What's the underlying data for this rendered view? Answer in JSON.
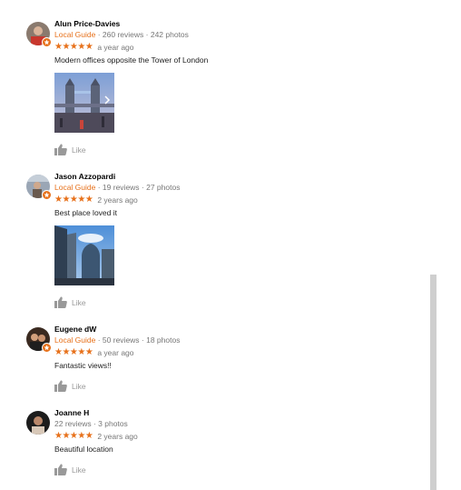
{
  "reviews": [
    {
      "name": "Alun Price-Davies",
      "local_guide": "Local Guide",
      "stats": " · 260 reviews · 242 photos",
      "stars": "★★★★★",
      "time": "a year ago",
      "text": "Modern offices opposite the Tower of London",
      "like": "Like"
    },
    {
      "name": "Jason Azzopardi",
      "local_guide": "Local Guide",
      "stats": " · 19 reviews · 27 photos",
      "stars": "★★★★★",
      "time": "2 years ago",
      "text": "Best place loved it",
      "like": "Like"
    },
    {
      "name": "Eugene dW",
      "local_guide": "Local Guide",
      "stats": " · 50 reviews · 18 photos",
      "stars": "★★★★★",
      "time": "a year ago",
      "text": "Fantastic views!!",
      "like": "Like"
    },
    {
      "name": "Joanne H",
      "stats": "22 reviews · 3 photos",
      "stars": "★★★★★",
      "time": "2 years ago",
      "text": "Beautiful location",
      "like": "Like"
    }
  ],
  "colors": {
    "accent": "#e7711b",
    "meta": "#777777",
    "like": "#999999"
  },
  "icons": [
    "local-guide-badge-icon",
    "thumbs-up-icon"
  ]
}
